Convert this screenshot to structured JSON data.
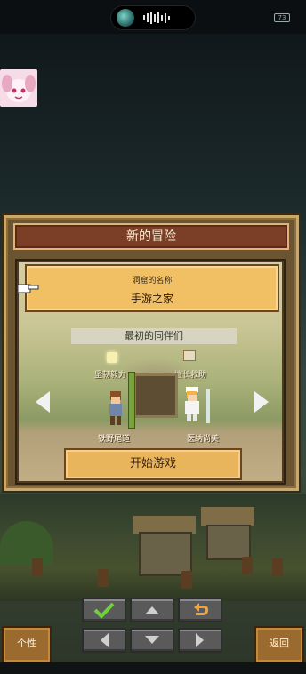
{
  "dialog": {
    "title": "新的冒险",
    "cave_name_label": "洞窟的名称",
    "cave_name_value": "手游之家",
    "party_header": "最初的同伴们",
    "start_button": "开始游戏"
  },
  "party": {
    "left": {
      "skill": "坚韧毅力",
      "name": "铁野尾道"
    },
    "right": {
      "skill": "擅长救助",
      "name": "医纳尚美"
    }
  },
  "status_bar": {
    "battery": "73"
  },
  "controls": {
    "left_button": "个性",
    "right_button": "返回"
  },
  "colors": {
    "title_bar": "#7a3f26",
    "name_box": "#f2c064",
    "start_button": "#e8b55c",
    "side_button": "#9a6a2e",
    "confirm_check": "#6fd23a",
    "back_arrow": "#f0a33a"
  },
  "icons": {
    "confirm": "check-icon",
    "up": "arrow-up-icon",
    "down": "arrow-down-icon",
    "left": "arrow-left-icon",
    "right": "arrow-right-icon",
    "back": "undo-icon"
  }
}
